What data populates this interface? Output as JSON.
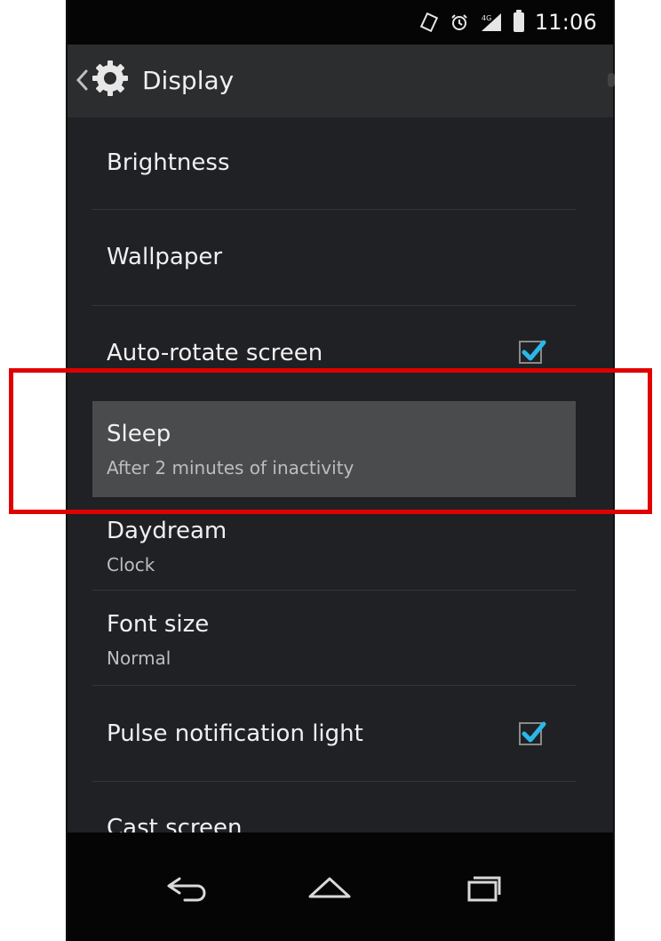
{
  "status_bar": {
    "time": "11:06",
    "icons": [
      "rotate-icon",
      "alarm-icon",
      "4g-signal-icon",
      "battery-icon"
    ]
  },
  "action_bar": {
    "title": "Display",
    "icons": [
      "back-chevron-icon",
      "gear-icon"
    ]
  },
  "settings": [
    {
      "label": "Brightness"
    },
    {
      "label": "Wallpaper"
    },
    {
      "label": "Auto-rotate screen",
      "checkbox": true
    },
    {
      "label": "Sleep",
      "summary": "After 2 minutes of inactivity"
    },
    {
      "label": "Daydream",
      "summary": "Clock"
    },
    {
      "label": "Font size",
      "summary": "Normal"
    },
    {
      "label": "Pulse notification light",
      "checkbox": true
    },
    {
      "label": "Cast screen"
    }
  ],
  "highlight": {
    "item": "Sleep",
    "frame_color": "#e00000"
  },
  "navigation": {
    "icons": [
      "back-icon",
      "home-icon",
      "recents-icon"
    ]
  },
  "theme": {
    "background": "#1f2124",
    "status_bar": "#050505",
    "accent": "#2bb7e8"
  }
}
